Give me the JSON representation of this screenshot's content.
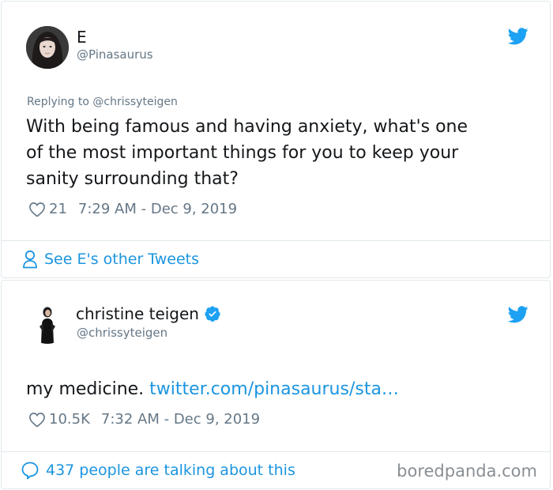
{
  "tweet1": {
    "author_initial": "E",
    "handle": "@Pinasaurus",
    "reply_to": "Replying to @chrissyteigen",
    "text_lines": [
      "With being famous and having anxiety, what's one",
      "of the most important things for you to keep your",
      "sanity surrounding that?"
    ],
    "likes": "21",
    "timestamp": "7:29 AM - Dec 9, 2019",
    "footer": "See E's other Tweets",
    "icons": [
      "avatar",
      "twitter-bird-icon",
      "heart-icon",
      "person-icon"
    ]
  },
  "tweet2": {
    "author_name": "christine teigen",
    "handle": "@chrissyteigen",
    "text": "my medicine.",
    "link": "twitter.com/pinasaurus/sta…",
    "likes": "10.5K",
    "timestamp": "7:32 AM - Dec 9, 2019",
    "footer": "437 people are talking about this",
    "icons": [
      "avatar",
      "verified-badge-icon",
      "twitter-bird-icon",
      "heart-icon",
      "speech-bubble-icon"
    ]
  },
  "watermark": "boredpanda.com",
  "colors": {
    "link": "#1b95e0",
    "muted": "#657786",
    "text": "#14171a",
    "border": "#e1e8ed"
  }
}
